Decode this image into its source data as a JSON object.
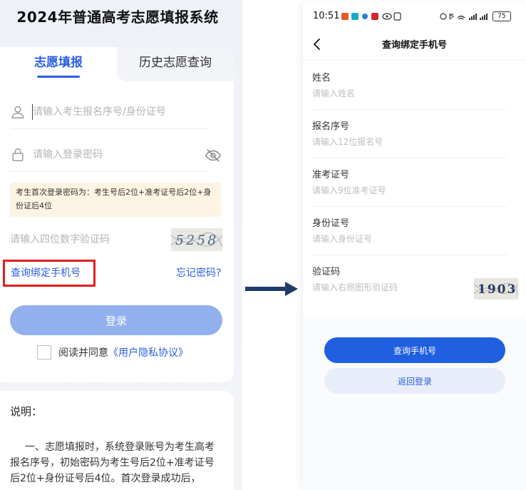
{
  "left": {
    "title": "2024年普通高考志愿填报系统",
    "tabs": [
      {
        "label": "志愿填报",
        "active": true
      },
      {
        "label": "历史志愿查询",
        "active": false
      }
    ],
    "fields": {
      "candidate_id_placeholder": "请输入考生报名序号/身份证号",
      "password_placeholder": "请输入登录密码",
      "captcha_placeholder": "请输入四位数字验证码"
    },
    "tip_text": "考生首次登录密码为：考生号后2位+准考证号后2位+身份证后4位",
    "captcha_code": "5258",
    "bind_phone_link": "查询绑定手机号",
    "forgot_link": "忘记密码?",
    "login_button": "登录",
    "agree_prefix": "阅读并同意",
    "agree_link": "《用户隐私协议》",
    "note_title": "说明：",
    "note_body": "一、志愿填报时，系统登录账号为考生高考报名序号，初始密码为考生号后2位+准考证号后2位+身份证号后4位。首次登录成功后，"
  },
  "right": {
    "status": {
      "time": "10:51",
      "battery": "75"
    },
    "nav_title": "查询绑定手机号",
    "fields": [
      {
        "label": "姓名",
        "placeholder": "请输入姓名"
      },
      {
        "label": "报名序号",
        "placeholder": "请输入12位报名号"
      },
      {
        "label": "准考证号",
        "placeholder": "请输入9位准考证号"
      },
      {
        "label": "身份证号",
        "placeholder": "请输入身份证号"
      },
      {
        "label": "验证码",
        "placeholder": "请输入右侧图形验证码"
      }
    ],
    "captcha_code": "1903",
    "query_button": "查询手机号",
    "back_button": "返回登录"
  },
  "colors": {
    "accent": "#2b5fe0",
    "primary_button": "#1f5fe0",
    "disabled_button": "#92b0ee",
    "highlight_box": "#e02020",
    "tip_background": "#fdf4e3",
    "arrow": "#1f3b6b"
  },
  "icons": [
    "user-icon",
    "lock-icon",
    "eye-off-icon",
    "back-chevron-icon",
    "right-arrow-icon"
  ]
}
